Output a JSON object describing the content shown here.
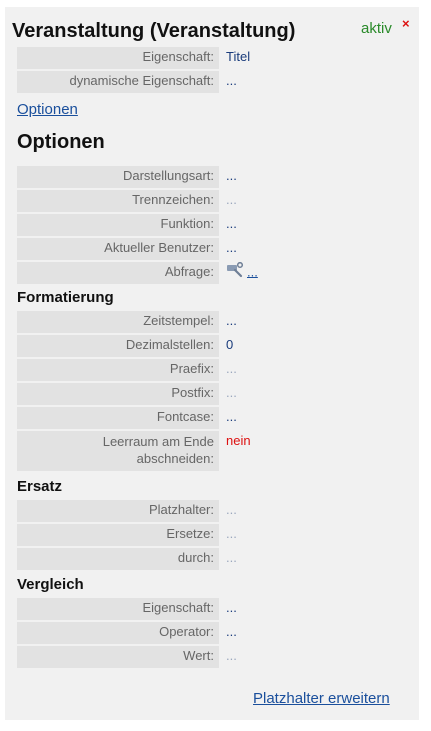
{
  "header": {
    "title": "Veranstaltung (Veranstaltung)",
    "status": "aktiv",
    "close_glyph": "×"
  },
  "basic": [
    {
      "label": "Eigenschaft:",
      "value": "Titel",
      "style": "dark"
    },
    {
      "label": "dynamische Eigenschaft:",
      "value": "...",
      "style": "dark"
    }
  ],
  "options_link": "Optionen",
  "options_heading": "Optionen",
  "options": [
    {
      "label": "Darstellungsart:",
      "value": "...",
      "style": "dark"
    },
    {
      "label": "Trennzeichen:",
      "value": "...",
      "style": "dim"
    },
    {
      "label": "Funktion:",
      "value": "...",
      "style": "dark"
    },
    {
      "label": "Aktueller Benutzer:",
      "value": "...",
      "style": "dark"
    },
    {
      "label": "Abfrage:",
      "value": "...",
      "style": "dark",
      "icon": "query-wrench-icon"
    }
  ],
  "formatting": {
    "heading": "Formatierung",
    "rows": [
      {
        "label": "Zeitstempel:",
        "value": "...",
        "style": "dark"
      },
      {
        "label": "Dezimalstellen:",
        "value": "0",
        "style": "dark"
      },
      {
        "label": "Praefix:",
        "value": "...",
        "style": "dim"
      },
      {
        "label": "Postfix:",
        "value": "...",
        "style": "dim"
      },
      {
        "label": "Fontcase:",
        "value": "...",
        "style": "dark"
      },
      {
        "label_line1": "Leerraum am Ende",
        "label_line2": "abschneiden:",
        "value": "nein",
        "style": "red"
      }
    ]
  },
  "replace": {
    "heading": "Ersatz",
    "rows": [
      {
        "label": "Platzhalter:",
        "value": "...",
        "style": "dim"
      },
      {
        "label": "Ersetze:",
        "value": "...",
        "style": "dim"
      },
      {
        "label": "durch:",
        "value": "...",
        "style": "dim"
      }
    ]
  },
  "compare": {
    "heading": "Vergleich",
    "rows": [
      {
        "label": "Eigenschaft:",
        "value": "...",
        "style": "dark"
      },
      {
        "label": "Operator:",
        "value": "...",
        "style": "dark"
      },
      {
        "label": "Wert:",
        "value": "...",
        "style": "dim"
      }
    ]
  },
  "footer_link": "Platzhalter erweitern"
}
